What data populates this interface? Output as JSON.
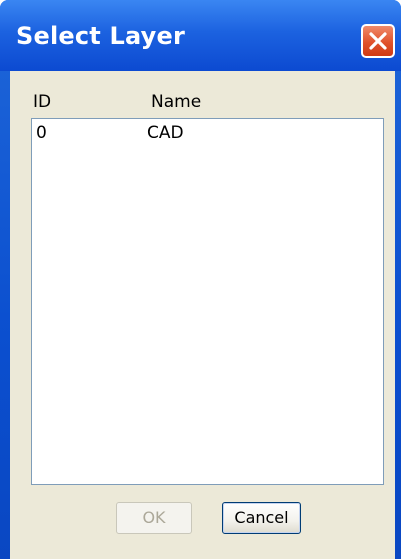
{
  "window": {
    "title": "Select Layer"
  },
  "list": {
    "columns": [
      "ID",
      "Name"
    ],
    "rows": [
      {
        "id": "0",
        "name": "CAD"
      }
    ]
  },
  "buttons": {
    "ok_label": "OK",
    "ok_enabled": false,
    "cancel_label": "Cancel"
  },
  "icons": {
    "close": "close-icon"
  },
  "colors": {
    "titlebar": "#1c62e0",
    "close_button": "#e0522c",
    "dialog_face": "#ece9d8",
    "list_border": "#7f9db9",
    "disabled_text": "#aca899"
  }
}
